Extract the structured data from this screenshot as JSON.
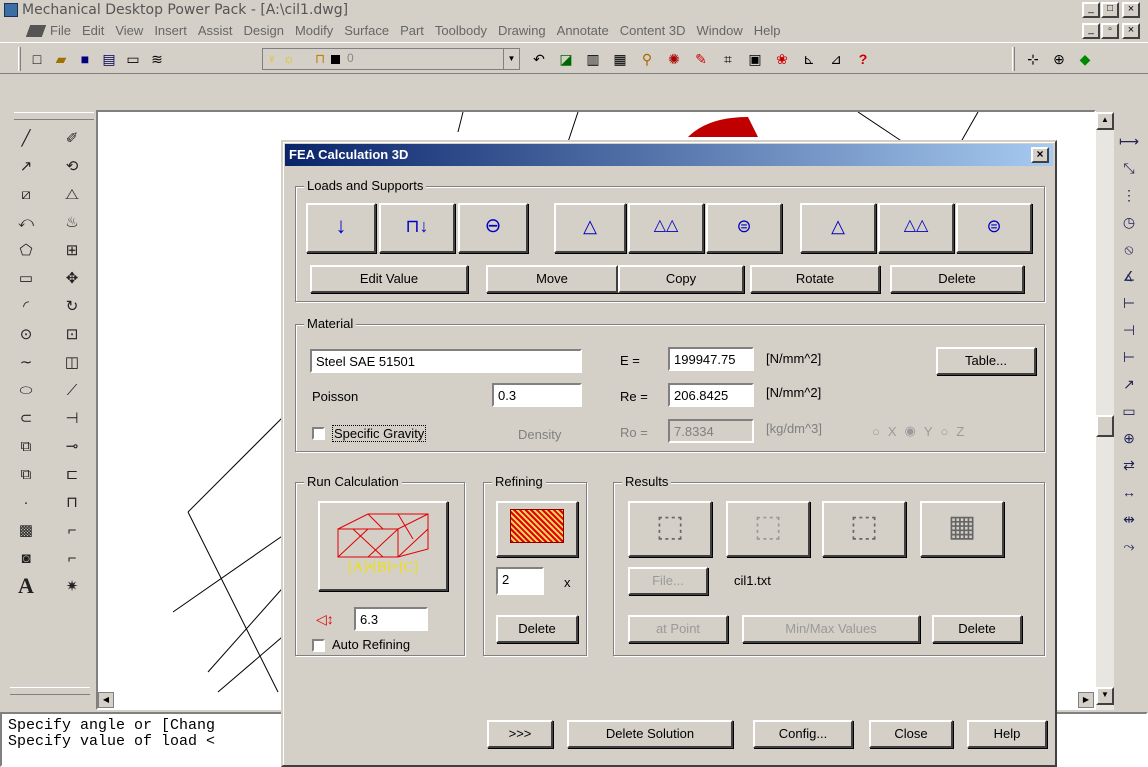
{
  "app": {
    "title": "Mechanical Desktop Power Pack - [A:\\cil1.dwg]"
  },
  "menu": [
    "File",
    "Edit",
    "View",
    "Insert",
    "Assist",
    "Design",
    "Modify",
    "Surface",
    "Part",
    "Toolbody",
    "Drawing",
    "Annotate",
    "Content 3D",
    "Window",
    "Help"
  ],
  "toolbar": {
    "layer_value": "0"
  },
  "command": {
    "line1": "Specify angle or [Chang",
    "line2": "Specify value of load <"
  },
  "dialog": {
    "title": "FEA Calculation 3D",
    "loads": {
      "group": "Loads and Supports",
      "edit": "Edit Value",
      "move": "Move",
      "copy": "Copy",
      "rotate": "Rotate",
      "delete": "Delete"
    },
    "material": {
      "group": "Material",
      "name": "Steel SAE 51501",
      "e_label": "E =",
      "e_value": "199947.75",
      "e_unit": "[N/mm^2]",
      "table": "Table...",
      "poisson_label": "Poisson",
      "poisson_value": "0.3",
      "re_label": "Re =",
      "re_value": "206.8425",
      "re_unit": "[N/mm^2]",
      "sg_label": "Specific Gravity",
      "density": "Density",
      "ro_label": "Ro =",
      "ro_value": "7.8334",
      "ro_unit": "[kg/dm^3]",
      "axis_x": "X",
      "axis_y": "Y",
      "axis_z": "Z"
    },
    "run": {
      "group": "Run Calculation",
      "formula": "[A]•[B]=[C]",
      "mesh_value": "6.3",
      "auto": "Auto Refining"
    },
    "refining": {
      "group": "Refining",
      "value": "2",
      "x": "x",
      "delete": "Delete"
    },
    "results": {
      "group": "Results",
      "file": "File...",
      "filename": "cil1.txt",
      "at_point": "at Point",
      "minmax": "Min/Max Values",
      "delete": "Delete"
    },
    "bottom": {
      "more": ">>>",
      "delete_solution": "Delete Solution",
      "config": "Config...",
      "close": "Close",
      "help": "Help"
    }
  }
}
